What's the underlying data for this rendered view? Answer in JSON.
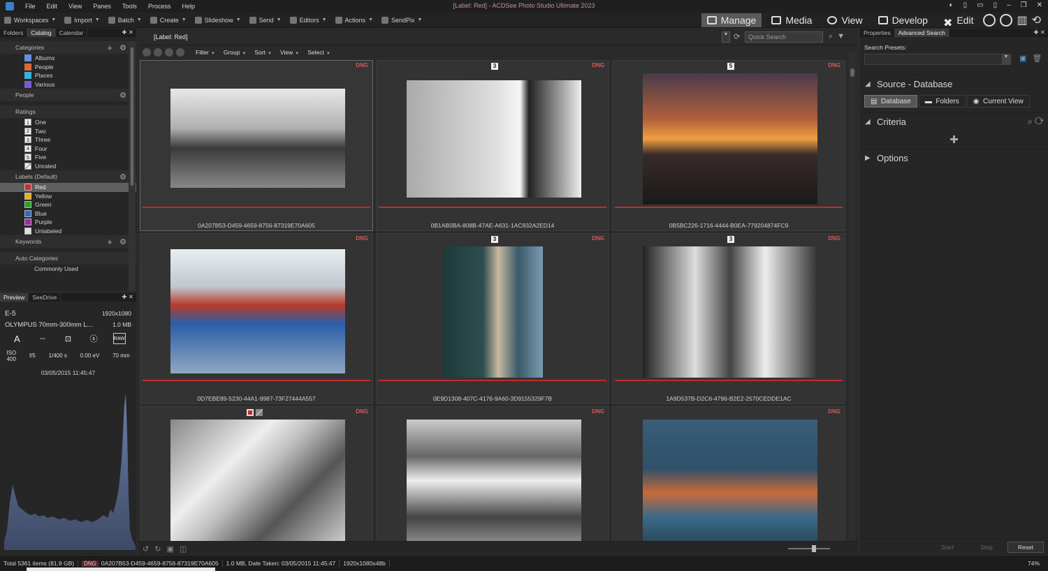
{
  "window": {
    "title": "[Label: Red] - ACDSee Photo Studio Ultimate 2023",
    "menu": [
      "File",
      "Edit",
      "View",
      "Panes",
      "Tools",
      "Process",
      "Help"
    ]
  },
  "toolbar": {
    "items": [
      {
        "label": "Workspaces",
        "caret": true
      },
      {
        "label": "Import",
        "caret": true
      },
      {
        "label": "Batch",
        "caret": true
      },
      {
        "label": "Create",
        "caret": true
      },
      {
        "label": "Slideshow",
        "caret": true
      },
      {
        "label": "Send",
        "caret": true
      },
      {
        "label": "Editors",
        "caret": true
      },
      {
        "label": "Actions",
        "caret": true
      },
      {
        "label": "SendPix",
        "caret": true
      }
    ]
  },
  "modes": {
    "manage": "Manage",
    "media": "Media",
    "view": "View",
    "develop": "Develop",
    "edit": "Edit"
  },
  "left_pane": {
    "tabs": [
      "Folders",
      "Catalog",
      "Calendar"
    ],
    "categories": {
      "header": "Categories",
      "items": [
        {
          "label": "Albums",
          "color": "#6b8fd8"
        },
        {
          "label": "People",
          "color": "#d86b3b"
        },
        {
          "label": "Places",
          "color": "#3bb3d8"
        },
        {
          "label": "Various",
          "color": "#7a5ad8"
        }
      ]
    },
    "people": {
      "header": "People"
    },
    "ratings": {
      "header": "Ratings",
      "items": [
        {
          "badge": "1",
          "label": "One"
        },
        {
          "badge": "2",
          "label": "Two"
        },
        {
          "badge": "3",
          "label": "Three"
        },
        {
          "badge": "4",
          "label": "Four"
        },
        {
          "badge": "5",
          "label": "Five"
        },
        {
          "badge": "",
          "label": "Unrated"
        }
      ]
    },
    "labels": {
      "header": "Labels (Default)",
      "items": [
        {
          "label": "Red",
          "color": "#d02a2a",
          "selected": true
        },
        {
          "label": "Yellow",
          "color": "#e0b020"
        },
        {
          "label": "Green",
          "color": "#2aa02a"
        },
        {
          "label": "Blue",
          "color": "#2a6ad0"
        },
        {
          "label": "Purple",
          "color": "#a02aa0"
        },
        {
          "label": "Unlabeled",
          "color": "#dddddd"
        }
      ]
    },
    "keywords": {
      "header": "Keywords"
    },
    "auto_categories": {
      "header": "Auto Categories",
      "sub": "Commonly Used"
    }
  },
  "preview_pane": {
    "tabs": [
      "Preview",
      "SeeDrive"
    ],
    "camera": "E-5",
    "dimensions": "1920x1080",
    "lens": "OLYMPUS 70mm-300mm L...",
    "size": "1.0 MB",
    "exif": {
      "iso_label": "ISO",
      "iso": "400",
      "aperture": "f/5",
      "shutter": "1/400 s",
      "exposure": "0.00 eV",
      "focal": "70 mm"
    },
    "date": "03/05/2015 11:45:47"
  },
  "browser": {
    "path": "[Label: Red]",
    "quick_search_placeholder": "Quick Search",
    "nav_menus": [
      "Filter",
      "Group",
      "Sort",
      "View",
      "Select"
    ],
    "thumbnails": [
      {
        "name": "0A207B53-D459-4659-8756-87319E70A605",
        "badge": "DNG",
        "rating": "",
        "tags": false,
        "selected": true
      },
      {
        "name": "0B1AB0BA-808B-47AE-A631-1AC932A2ED14",
        "badge": "DNG",
        "rating": "3",
        "tags": false
      },
      {
        "name": "0B5BC226-1716-4444-B0EA-779204874FC9",
        "badge": "DNG",
        "rating": "5",
        "tags": false
      },
      {
        "name": "0D7EBE89-5230-44A1-9987-73F27444A557",
        "badge": "DNG",
        "rating": "",
        "tags": false
      },
      {
        "name": "0E9D1308-407C-4176-9A60-3D9155329F7B",
        "badge": "DNG",
        "rating": "3",
        "tags": false
      },
      {
        "name": "1A9D537B-D2C6-4796-B2E2-2570CEDDE1AC",
        "badge": "DNG",
        "rating": "3",
        "tags": false
      },
      {
        "name": "",
        "badge": "DNG",
        "rating": "",
        "tags": true
      },
      {
        "name": "",
        "badge": "DNG",
        "rating": "",
        "tags": false
      },
      {
        "name": "",
        "badge": "DNG",
        "rating": "",
        "tags": false
      }
    ]
  },
  "right_pane": {
    "tabs": [
      "Properties",
      "Advanced Search"
    ],
    "presets_label": "Search Presets:",
    "source_header": "Source - Database",
    "source_buttons": [
      "Database",
      "Folders",
      "Current View"
    ],
    "criteria_header": "Criteria",
    "options_header": "Options",
    "footer": {
      "start": "Start",
      "stop": "Stop",
      "reset": "Reset"
    }
  },
  "status": {
    "total": "Total 5361 items  (81.9 GB)",
    "badge": "DNG",
    "file": "0A207B53-D459-4659-8756-87319E70A605",
    "info": "1.0 MB, Date Taken: 03/05/2015 11:45:47",
    "res": "1920x1080x48b",
    "zoom": "74%"
  }
}
